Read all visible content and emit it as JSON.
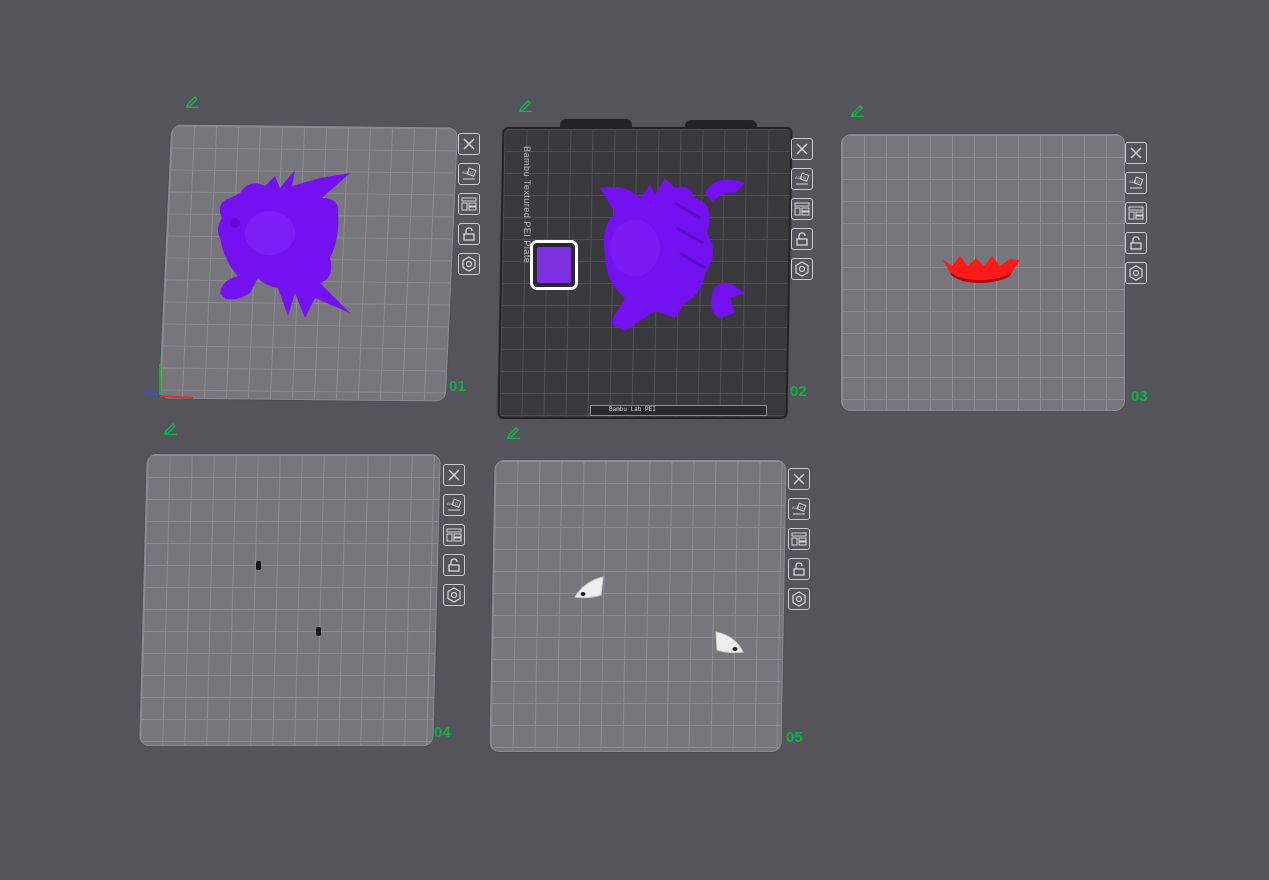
{
  "plates": [
    {
      "id": "01",
      "label": "01"
    },
    {
      "id": "02",
      "label": "02",
      "texture_label": "Bambu Textured PEI Plate",
      "strip_label": "Bambu Lab PEI"
    },
    {
      "id": "03",
      "label": "03"
    },
    {
      "id": "04",
      "label": "04"
    },
    {
      "id": "05",
      "label": "05"
    }
  ],
  "toolbar_icons": [
    "close-icon",
    "auto-orient-icon",
    "arrange-icon",
    "lock-icon",
    "settings-icon"
  ],
  "colors": {
    "background": "#55545a",
    "plate_gray": "#77767c",
    "plate_dark": "#3a393e",
    "plate_label": "#10b04a",
    "model_purple": "#7311f0",
    "model_red": "#ff1a1a",
    "model_white": "#eeeeee"
  }
}
